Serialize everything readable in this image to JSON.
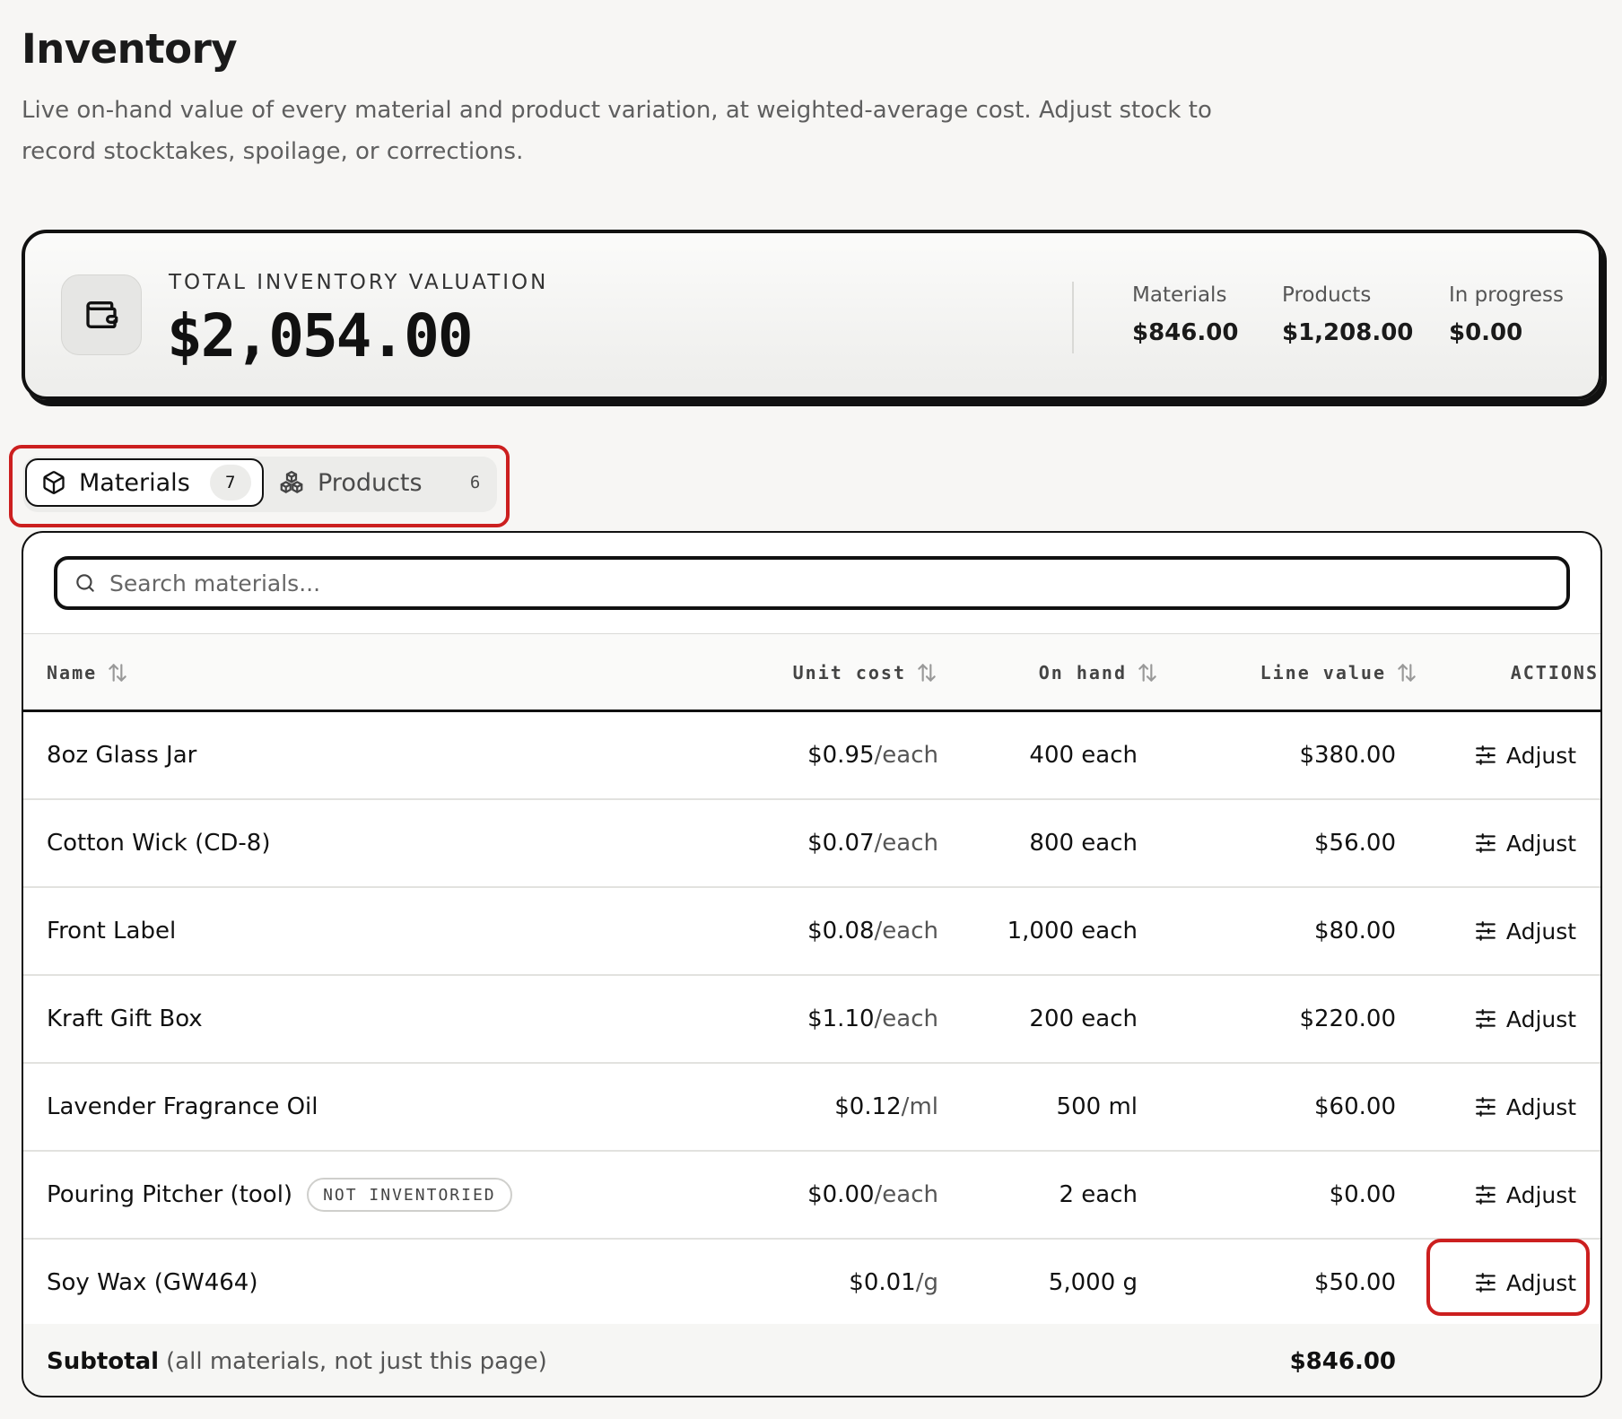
{
  "page": {
    "title": "Inventory",
    "description": "Live on-hand value of every material and product variation, at weighted-average cost. Adjust stock to record stocktakes, spoilage, or corrections."
  },
  "summary": {
    "icon": "wallet-icon",
    "label": "TOTAL INVENTORY VALUATION",
    "total": "$2,054.00",
    "stats": [
      {
        "label": "Materials",
        "value": "$846.00"
      },
      {
        "label": "Products",
        "value": "$1,208.00"
      },
      {
        "label": "In progress",
        "value": "$0.00"
      }
    ]
  },
  "tabs": [
    {
      "label": "Materials",
      "count": "7",
      "icon": "box-icon",
      "active": true
    },
    {
      "label": "Products",
      "count": "6",
      "icon": "boxes-icon",
      "active": false
    }
  ],
  "search": {
    "placeholder": "Search materials...",
    "value": ""
  },
  "table": {
    "columns": {
      "name": "Name",
      "unit_cost": "Unit cost",
      "on_hand": "On hand",
      "line_value": "Line value",
      "actions": "ACTIONS"
    },
    "action_label": "Adjust",
    "rows": [
      {
        "name": "8oz Glass Jar",
        "badge": "",
        "price": "$0.95",
        "unit": "each",
        "on_hand": "400 each",
        "line_value": "$380.00"
      },
      {
        "name": "Cotton Wick (CD-8)",
        "badge": "",
        "price": "$0.07",
        "unit": "each",
        "on_hand": "800 each",
        "line_value": "$56.00"
      },
      {
        "name": "Front Label",
        "badge": "",
        "price": "$0.08",
        "unit": "each",
        "on_hand": "1,000 each",
        "line_value": "$80.00"
      },
      {
        "name": "Kraft Gift Box",
        "badge": "",
        "price": "$1.10",
        "unit": "each",
        "on_hand": "200 each",
        "line_value": "$220.00"
      },
      {
        "name": "Lavender Fragrance Oil",
        "badge": "",
        "price": "$0.12",
        "unit": "ml",
        "on_hand": "500 ml",
        "line_value": "$60.00"
      },
      {
        "name": "Pouring Pitcher (tool)",
        "badge": "NOT INVENTORIED",
        "price": "$0.00",
        "unit": "each",
        "on_hand": "2 each",
        "line_value": "$0.00"
      },
      {
        "name": "Soy Wax (GW464)",
        "badge": "",
        "price": "$0.01",
        "unit": "g",
        "on_hand": "5,000 g",
        "line_value": "$50.00"
      }
    ],
    "subtotal": {
      "label": "Subtotal",
      "note": "(all materials, not just this page)",
      "value": "$846.00"
    }
  },
  "colors": {
    "accent": "#111111",
    "highlight": "#cc1f1f",
    "background": "#f7f6f4"
  }
}
